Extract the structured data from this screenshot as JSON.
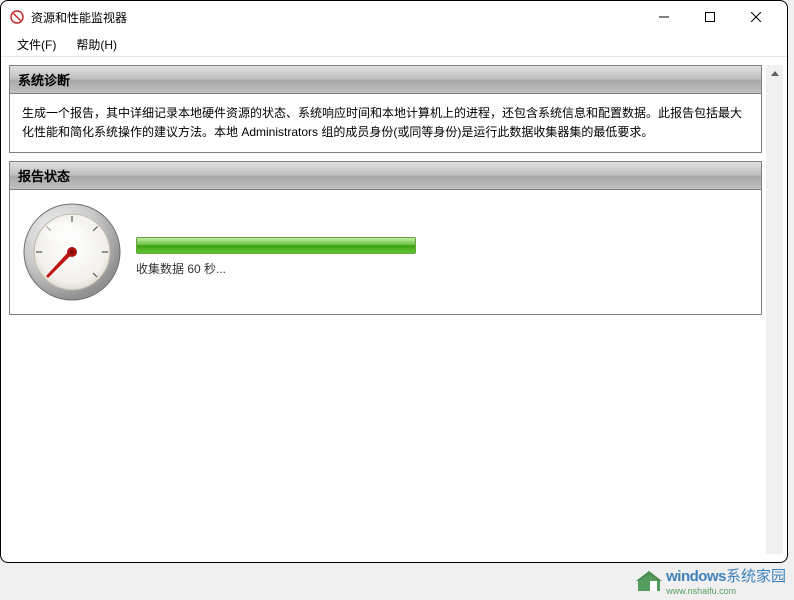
{
  "window": {
    "title": "资源和性能监视器"
  },
  "menu": {
    "file": "文件(F)",
    "help": "帮助(H)"
  },
  "panels": {
    "diagnosis": {
      "title": "系统诊断",
      "body": "生成一个报告，其中详细记录本地硬件资源的状态、系统响应时间和本地计算机上的进程，还包含系统信息和配置数据。此报告包括最大化性能和简化系统操作的建议方法。本地 Administrators 组的成员身份(或同等身份)是运行此数据收集器集的最低要求。"
    },
    "status": {
      "title": "报告状态",
      "progress_label": "收集数据 60 秒..."
    }
  },
  "watermark": {
    "brand_a": "windows",
    "brand_b": "系统家园",
    "url": "www.nshaifu.com"
  }
}
